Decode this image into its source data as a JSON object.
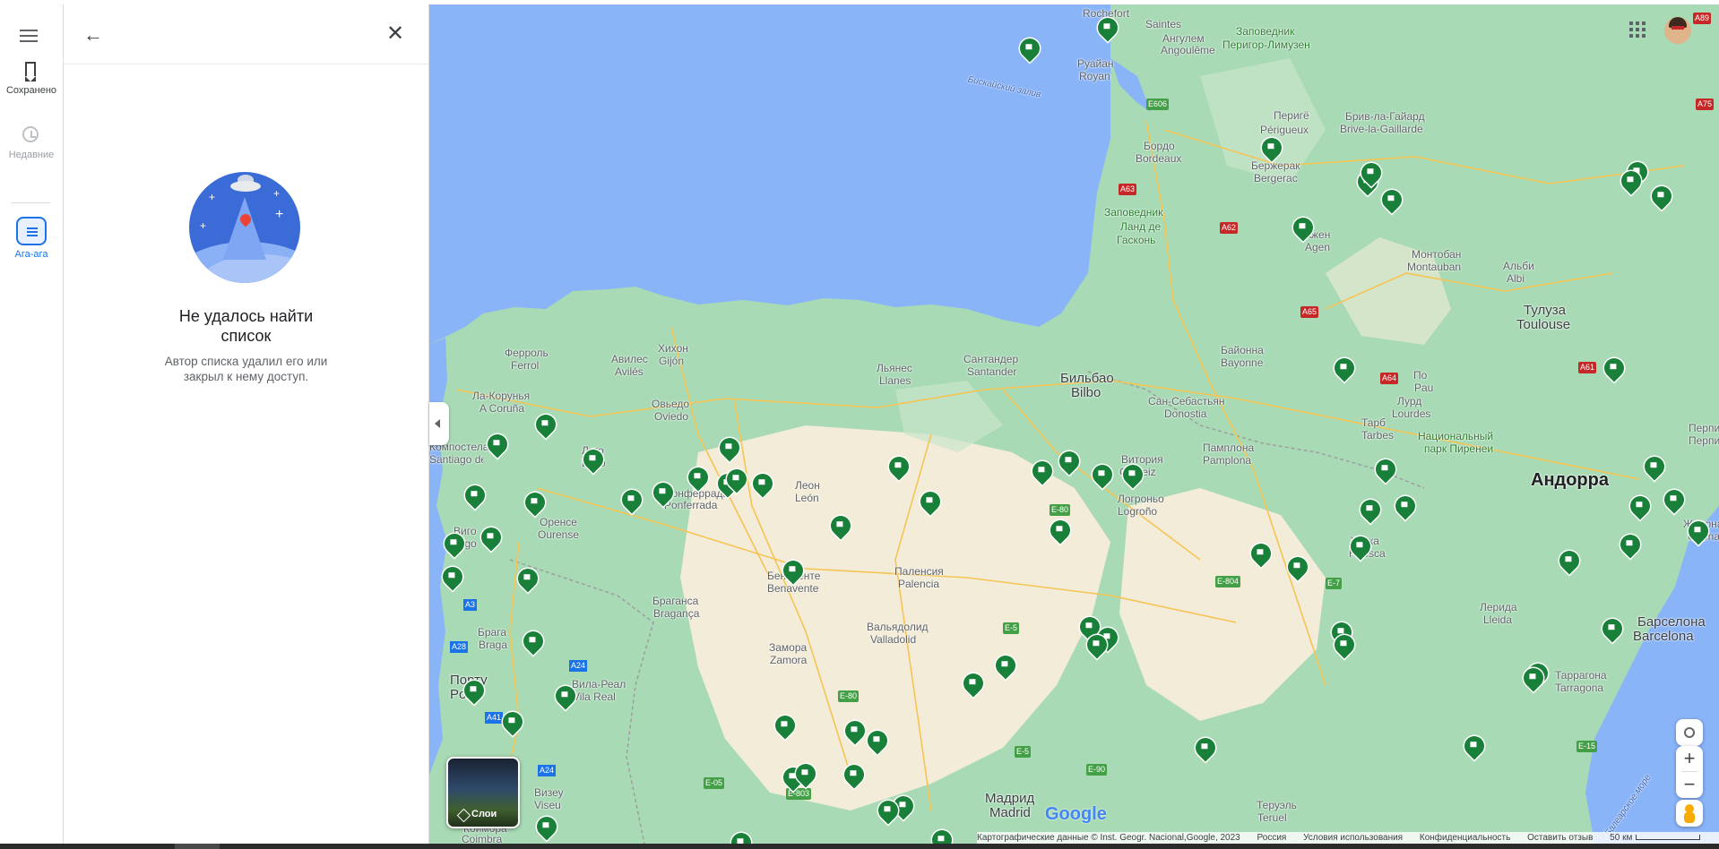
{
  "rail": {
    "saved_label": "Сохранено",
    "recent_label": "Недавние",
    "list_label": "Ага-ага"
  },
  "panel": {
    "error_title_line1": "Не удалось найти",
    "error_title_line2": "список",
    "error_sub_line1": "Автор списка удалил его или",
    "error_sub_line2": "закрыл к нему доступ."
  },
  "map": {
    "places": [
      {
        "t": "Rochefort",
        "k": ""
      },
      {
        "t": "Saintes",
        "k": ""
      },
      {
        "t": "Ангулем",
        "k": ""
      },
      {
        "t": "Angoulême",
        "k": ""
      },
      {
        "t": "Руайан",
        "k": ""
      },
      {
        "t": "Royan",
        "k": ""
      },
      {
        "t": "Заповедник",
        "k": "park"
      },
      {
        "t": "Перигор-Лимузен",
        "k": "park"
      },
      {
        "t": "Бискайский залив",
        "k": "sea"
      },
      {
        "t": "Бордо",
        "k": ""
      },
      {
        "t": "Bordeaux",
        "k": ""
      },
      {
        "t": "Перигё",
        "k": ""
      },
      {
        "t": "Périgueux",
        "k": ""
      },
      {
        "t": "Брив-ла-Гайард",
        "k": ""
      },
      {
        "t": "Brive-la-Gaillarde",
        "k": ""
      },
      {
        "t": "Бержерак",
        "k": ""
      },
      {
        "t": "Bergerac",
        "k": ""
      },
      {
        "t": "Заповедник",
        "k": "park"
      },
      {
        "t": "Ланд де",
        "k": "park"
      },
      {
        "t": "Гасконь",
        "k": "park"
      },
      {
        "t": "Ажен",
        "k": ""
      },
      {
        "t": "Agen",
        "k": ""
      },
      {
        "t": "Монтобан",
        "k": ""
      },
      {
        "t": "Montauban",
        "k": ""
      },
      {
        "t": "Альби",
        "k": ""
      },
      {
        "t": "Albi",
        "k": ""
      },
      {
        "t": "Тулуза",
        "k": "big"
      },
      {
        "t": "Toulouse",
        "k": "big"
      },
      {
        "t": "Байонна",
        "k": ""
      },
      {
        "t": "Bayonne",
        "k": ""
      },
      {
        "t": "По",
        "k": ""
      },
      {
        "t": "Pau",
        "k": ""
      },
      {
        "t": "Лурд",
        "k": ""
      },
      {
        "t": "Lourdes",
        "k": ""
      },
      {
        "t": "Тарб",
        "k": ""
      },
      {
        "t": "Tarbes",
        "k": ""
      },
      {
        "t": "Национальный",
        "k": "park"
      },
      {
        "t": "парк Пиренеи",
        "k": "park"
      },
      {
        "t": "Андорра",
        "k": "country"
      },
      {
        "t": "Ферроль",
        "k": ""
      },
      {
        "t": "Ferrol",
        "k": ""
      },
      {
        "t": "Хихон",
        "k": ""
      },
      {
        "t": "Gijón",
        "k": ""
      },
      {
        "t": "Авилес",
        "k": ""
      },
      {
        "t": "Avilés",
        "k": ""
      },
      {
        "t": "Льянес",
        "k": ""
      },
      {
        "t": "Llanes",
        "k": ""
      },
      {
        "t": "Сантандер",
        "k": ""
      },
      {
        "t": "Santander",
        "k": ""
      },
      {
        "t": "Бильбао",
        "k": "big"
      },
      {
        "t": "Bilbo",
        "k": "big"
      },
      {
        "t": "Сан-Себастьян",
        "k": ""
      },
      {
        "t": "Donostia",
        "k": ""
      },
      {
        "t": "Ла-Корунья",
        "k": ""
      },
      {
        "t": "A Coruña",
        "k": ""
      },
      {
        "t": "Овьедо",
        "k": ""
      },
      {
        "t": "Oviedo",
        "k": ""
      },
      {
        "t": "Луго",
        "k": ""
      },
      {
        "t": "Lugo",
        "k": ""
      },
      {
        "t": "Витория",
        "k": ""
      },
      {
        "t": "Gasteiz",
        "k": ""
      },
      {
        "t": "Памплона",
        "k": ""
      },
      {
        "t": "Pamplona",
        "k": ""
      },
      {
        "t": "Компостела",
        "k": ""
      },
      {
        "t": "Santiago de Compostela",
        "k": ""
      },
      {
        "t": "Понферрада",
        "k": ""
      },
      {
        "t": "Ponferrada",
        "k": ""
      },
      {
        "t": "Леон",
        "k": ""
      },
      {
        "t": "León",
        "k": ""
      },
      {
        "t": "Логроньо",
        "k": ""
      },
      {
        "t": "Logroño",
        "k": ""
      },
      {
        "t": "Оренсе",
        "k": ""
      },
      {
        "t": "Ourense",
        "k": ""
      },
      {
        "t": "Виго",
        "k": ""
      },
      {
        "t": "Vigo",
        "k": ""
      },
      {
        "t": "Уэска",
        "k": ""
      },
      {
        "t": "Huesca",
        "k": ""
      },
      {
        "t": "Бенавенте",
        "k": ""
      },
      {
        "t": "Benavente",
        "k": ""
      },
      {
        "t": "Паленсия",
        "k": ""
      },
      {
        "t": "Palencia",
        "k": ""
      },
      {
        "t": "Брагансa",
        "k": ""
      },
      {
        "t": "Bragança",
        "k": ""
      },
      {
        "t": "Вальядолид",
        "k": ""
      },
      {
        "t": "Valladolid",
        "k": ""
      },
      {
        "t": "Лерида",
        "k": ""
      },
      {
        "t": "Lleida",
        "k": ""
      },
      {
        "t": "Барселона",
        "k": "big"
      },
      {
        "t": "Barcelona",
        "k": "big"
      },
      {
        "t": "Брага",
        "k": ""
      },
      {
        "t": "Braga",
        "k": ""
      },
      {
        "t": "Замора",
        "k": ""
      },
      {
        "t": "Zamora",
        "k": ""
      },
      {
        "t": "Вила-Реал",
        "k": ""
      },
      {
        "t": "Vila Real",
        "k": ""
      },
      {
        "t": "Порту",
        "k": "big"
      },
      {
        "t": "Porto",
        "k": "big"
      },
      {
        "t": "Таррагона",
        "k": ""
      },
      {
        "t": "Tarragona",
        "k": ""
      },
      {
        "t": "Визеу",
        "k": ""
      },
      {
        "t": "Viseu",
        "k": ""
      },
      {
        "t": "Мадрид",
        "k": "big"
      },
      {
        "t": "Madrid",
        "k": "big"
      },
      {
        "t": "Теруэль",
        "k": ""
      },
      {
        "t": "Teruel",
        "k": ""
      },
      {
        "t": "Коимбра",
        "k": ""
      },
      {
        "t": "Coimbra",
        "k": ""
      },
      {
        "t": "Жирона",
        "k": ""
      },
      {
        "t": "Girona",
        "k": ""
      },
      {
        "t": "Перпиньян",
        "k": ""
      },
      {
        "t": "Перпинь",
        "k": ""
      },
      {
        "t": "Балеарское море",
        "k": "sea"
      }
    ],
    "road_labels": [
      "A89",
      "A75",
      "E606",
      "A63",
      "A62",
      "A65",
      "A64",
      "A61",
      "A3",
      "A28",
      "A24",
      "A41",
      "A24",
      "E-80",
      "E-804",
      "E-7",
      "E-5",
      "E-80",
      "E-05",
      "E-803",
      "E-5",
      "E-90",
      "E-15"
    ],
    "layers_label": "Слои",
    "google_logo": "Google",
    "attribution": [
      "Картографические данные © Inst. Geogr. Nacional,Google, 2023",
      "Россия",
      "Условия использования",
      "Конфиденциальность",
      "Оставить отзыв",
      "50 км"
    ]
  },
  "colors": {
    "sea": "#8ab4f8",
    "land": "#a8dab5",
    "plain": "#f3ecd9",
    "flag": "#188038",
    "accent": "#1a73e8"
  }
}
